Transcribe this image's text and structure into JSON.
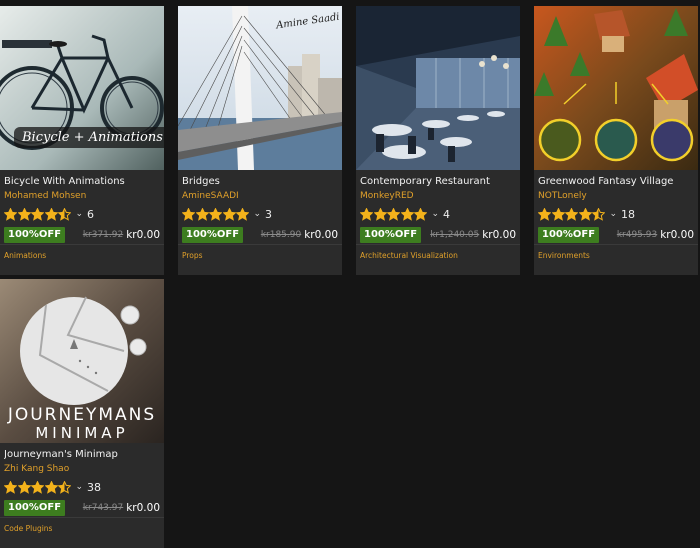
{
  "cards": [
    {
      "title": "Bicycle With Animations",
      "author": "Mohamed Mohsen",
      "rating": 4.5,
      "rating_count": "6",
      "badge": "100%OFF",
      "old_price": "kr371.92",
      "new_price": "kr0.00",
      "category": "Animations",
      "thumb_text": "Bicycle + Animations"
    },
    {
      "title": "Bridges",
      "author": "AmineSAADI",
      "rating": 5,
      "rating_count": "3",
      "badge": "100%OFF",
      "old_price": "kr185.90",
      "new_price": "kr0.00",
      "category": "Props",
      "thumb_text": "Amine Saadi"
    },
    {
      "title": "Contemporary Restaurant",
      "author": "MonkeyRED",
      "rating": 5,
      "rating_count": "4",
      "badge": "100%OFF",
      "old_price": "kr1,240.05",
      "new_price": "kr0.00",
      "category": "Architectural Visualization"
    },
    {
      "title": "Greenwood Fantasy Village",
      "author": "NOTLonely",
      "rating": 4.5,
      "rating_count": "18",
      "badge": "100%OFF",
      "old_price": "kr495.93",
      "new_price": "kr0.00",
      "category": "Environments"
    },
    {
      "title": "Journeyman's Minimap",
      "author": "Zhi Kang Shao",
      "rating": 4.5,
      "rating_count": "38",
      "badge": "100%OFF",
      "old_price": "kr743.97",
      "new_price": "kr0.00",
      "category": "Code Plugins",
      "thumb_text_line1": "JOURNEYMANS",
      "thumb_text_line2": "MINIMAP"
    }
  ],
  "icons": {
    "star": "star-icon",
    "chevron": "chevron-down-icon"
  },
  "colors": {
    "star": "#f3b21b",
    "badge": "#3d7d1f",
    "accent": "#e0a02a",
    "card_bg": "#2b2b2b",
    "page_bg": "#151515"
  }
}
